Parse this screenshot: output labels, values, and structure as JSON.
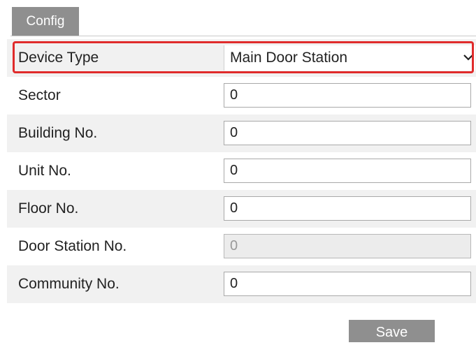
{
  "tabs": [
    {
      "label": "Config"
    }
  ],
  "form": {
    "device_type": {
      "label": "Device Type",
      "value": "Main Door Station"
    },
    "sector": {
      "label": "Sector",
      "value": "0"
    },
    "building": {
      "label": "Building No.",
      "value": "0"
    },
    "unit": {
      "label": "Unit No.",
      "value": "0"
    },
    "floor": {
      "label": "Floor No.",
      "value": "0"
    },
    "door_station": {
      "label": "Door Station No.",
      "value": "0",
      "disabled": true
    },
    "community": {
      "label": "Community No.",
      "value": "0"
    }
  },
  "actions": {
    "save_label": "Save"
  },
  "colors": {
    "tab_bg": "#8f8f8f",
    "alt_row_bg": "#f1f1f1",
    "highlight_border": "#e02b2b",
    "button_bg": "#8f8f8f"
  }
}
